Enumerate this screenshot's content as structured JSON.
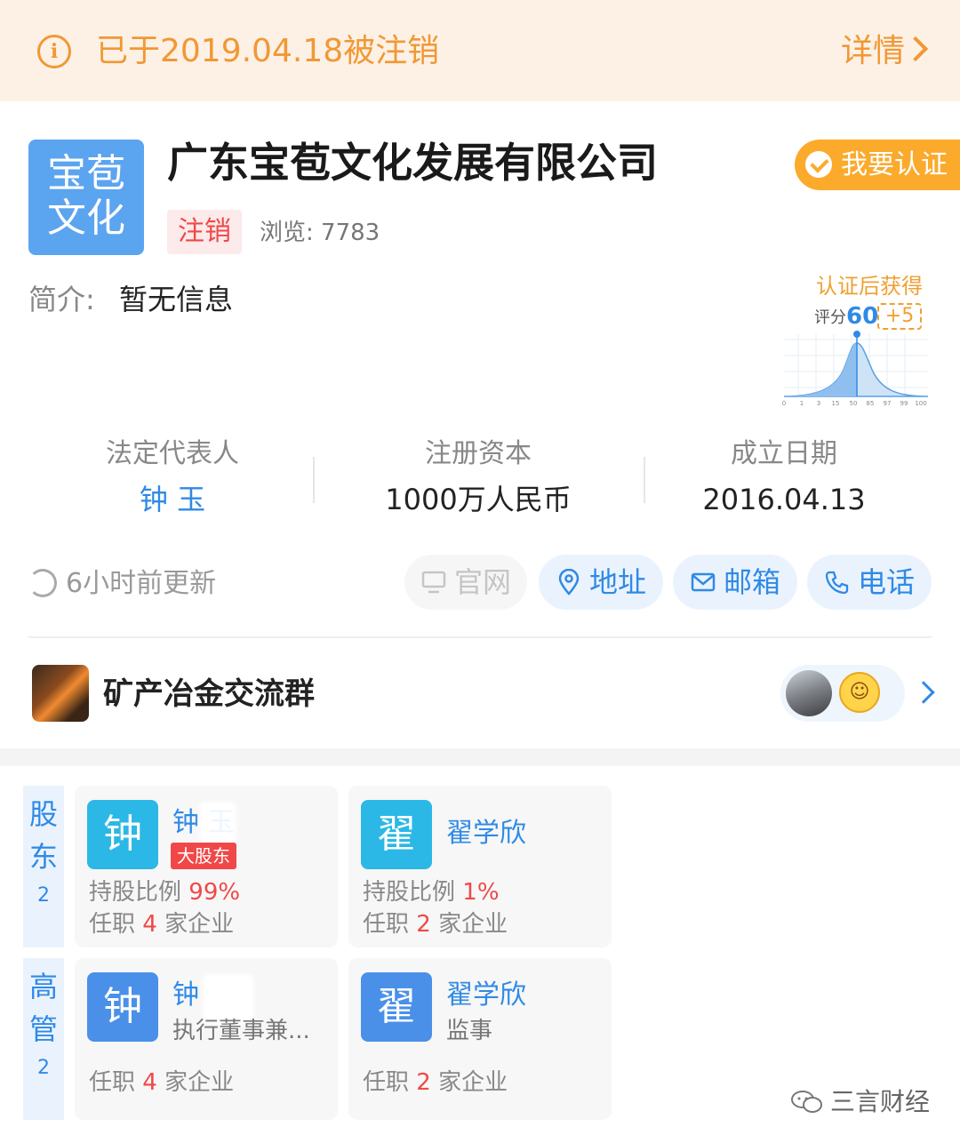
{
  "banner": {
    "status_text": "已于2019.04.18被注销",
    "detail_label": "详情"
  },
  "company": {
    "logo_line1": "宝苞",
    "logo_line2": "文化",
    "name": "广东宝苞文化发展有限公司",
    "status_tag": "注销",
    "views": "浏览: 7783",
    "cert_button": "我要认证",
    "intro_label": "简介:",
    "intro_value": "暂无信息"
  },
  "score": {
    "title": "认证后获得",
    "label": "评分",
    "value": "60",
    "bonus": "+5",
    "axis_ticks": [
      "0",
      "1",
      "3",
      "15",
      "50",
      "85",
      "97",
      "99",
      "100"
    ]
  },
  "info": {
    "legal_rep_label": "法定代表人",
    "legal_rep_value": "钟 玉",
    "capital_label": "注册资本",
    "capital_value": "1000万人民币",
    "founded_label": "成立日期",
    "founded_value": "2016.04.13"
  },
  "actions": {
    "updated": "6小时前更新",
    "website": "官网",
    "address": "地址",
    "email": "邮箱",
    "phone": "电话"
  },
  "group": {
    "name": "矿产冶金交流群"
  },
  "shareholders": {
    "tab_label": "股东",
    "count": "2",
    "people": [
      {
        "avatar": "钟",
        "name": "钟 玉",
        "tag": "大股东",
        "ratio_label": "持股比例",
        "ratio": "99%",
        "job_prefix": "任职",
        "job_count": "4",
        "job_suffix": "家企业"
      },
      {
        "avatar": "翟",
        "name": "翟学欣",
        "ratio_label": "持股比例",
        "ratio": "1%",
        "job_prefix": "任职",
        "job_count": "2",
        "job_suffix": "家企业"
      }
    ]
  },
  "executives": {
    "tab_label": "高管",
    "count": "2",
    "people": [
      {
        "avatar": "钟",
        "name": "钟",
        "role": "执行董事兼...",
        "job_prefix": "任职",
        "job_count": "4",
        "job_suffix": "家企业"
      },
      {
        "avatar": "翟",
        "name": "翟学欣",
        "role": "监事",
        "job_prefix": "任职",
        "job_count": "2",
        "job_suffix": "家企业"
      }
    ]
  },
  "watermark": "三言财经",
  "colors": {
    "accent_orange": "#f19834",
    "accent_blue": "#2f8ae6",
    "status_red": "#f04848",
    "cert_orange": "#fbaa2c"
  }
}
